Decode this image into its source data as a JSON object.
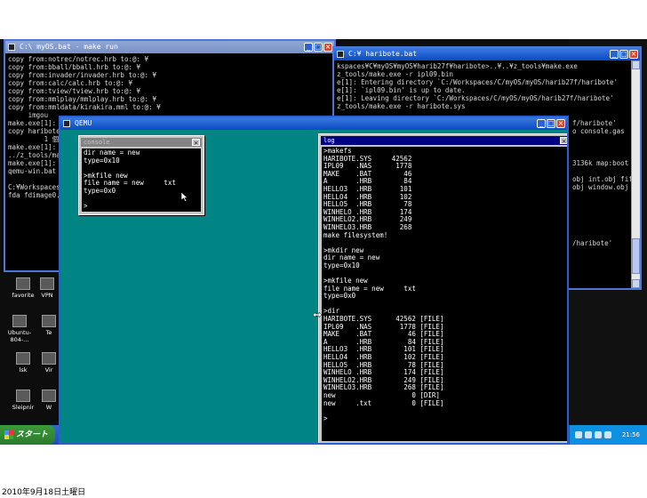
{
  "slide": {
    "caption": "2010年9月18日土曜日"
  },
  "left_cmd": {
    "title": "C:\\ myOS.bat - make run",
    "lines": [
      "copy from:notrec/notrec.hrb to:@: ¥",
      "copy from:bball/bball.hrb to:@: ¥",
      "copy from:invader/invader.hrb to:@: ¥",
      "copy from:calc/calc.hrb to:@: ¥",
      "copy from:tview/tview.hrb to:@: ¥",
      "copy from:mmlplay/mmlplay.hrb to:@: ¥",
      "copy from:mmldata/kirakira.mml to:@: ¥",
      "     imgou",
      "make.exe[1]: L",
      "copy haribote",
      "         1 個の",
      "make.exe[1]: L",
      "../z_tools/mak",
      "make.exe[1]: L",
      "qemu-win.bat",
      "",
      "C:¥Workspaces",
      "fda fdimage0."
    ]
  },
  "right_cmd": {
    "title": "C:¥ haribote.bat",
    "lines": [
      "kspaces¥C¥myOS¥myOS¥harib27f¥haribote>..¥..¥z_tools¥make.exe",
      "z_tools/make.exe -r ipl09.bin",
      "e[1]: Entering directory `C:/Workspaces/C/myOS/myOS/harib27f/haribote'",
      "e[1]: `ipl09.bin' is up to date.",
      "e[1]: Leaving directory `C:/Workspaces/C/myOS/myOS/harib27f/haribote'",
      "z_tools/make.exe -r haribote.sys"
    ],
    "lines_lower": [
      "f/haribote'",
      "o console.gas",
      "",
      "",
      "",
      "3136k map:boot",
      "",
      "obj int.obj fif",
      "obj window.obj",
      "",
      "",
      "",
      "",
      "",
      "",
      "/haribote'"
    ]
  },
  "desktop_icons": [
    {
      "label": "favorite"
    },
    {
      "label": "VPN"
    },
    {
      "label": "Ubuntu-804-..."
    },
    {
      "label": "Te"
    },
    {
      "label": "lsk"
    },
    {
      "label": "Vir"
    },
    {
      "label": "Sleipnir"
    },
    {
      "label": "W"
    }
  ],
  "taskbar": {
    "start_label": "スタート",
    "clock": "21:56"
  },
  "qemu": {
    "title": "QEMU",
    "console": {
      "title": "console",
      "lines": [
        "dir name = new",
        "type=0x10",
        "",
        ">mkfile new",
        "file name = new     txt",
        "type=0x0",
        "",
        ">"
      ]
    },
    "log": {
      "title": "log",
      "lines": [
        ">makefs",
        "HARIBOTE.SYS     42562",
        "IPL09   .NAS      1778",
        "MAKE    .BAT        46",
        "A       .HRB        84",
        "HELLO3  .HRB       101",
        "HELLO4  .HRB       102",
        "HELLO5  .HRB        78",
        "WINHELO .HRB       174",
        "WINHELO2.HRB       249",
        "WINHELO3.HRB       268",
        "make filesystem!",
        "",
        ">mkdir new",
        "dir name = new",
        "type=0x10",
        "",
        ">mkfile new",
        "file name = new     txt",
        "type=0x0",
        "",
        ">dir",
        "HARIBOTE.SYS      42562 [FILE]",
        "IPL09   .NAS       1778 [FILE]",
        "MAKE    .BAT         46 [FILE]",
        "A       .HRB         84 [FILE]",
        "HELLO3  .HRB        101 [FILE]",
        "HELLO4  .HRB        102 [FILE]",
        "HELLO5  .HRB         78 [FILE]",
        "WINHELO .HRB        174 [FILE]",
        "WINHELO2.HRB        249 [FILE]",
        "WINHELO3.HRB        268 [FILE]",
        "new                   0 [DIR]",
        "new     .txt          0 [FILE]",
        "",
        ">"
      ]
    }
  },
  "colors": {
    "qemu_bg": "#008484",
    "active_title": "#000084",
    "xp_title": "#0a4bc4",
    "taskbar": "#1d4fb8"
  }
}
